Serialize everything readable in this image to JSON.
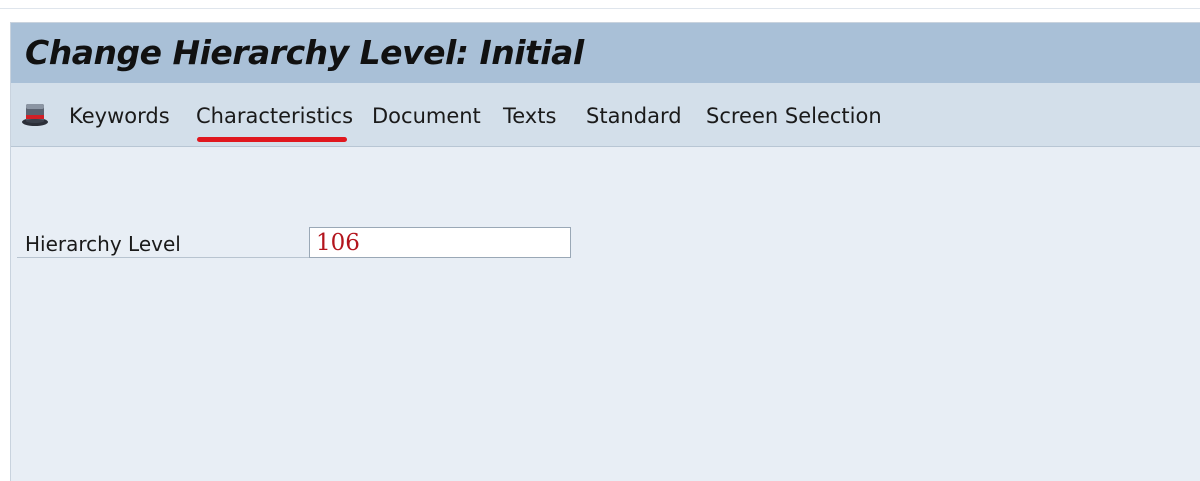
{
  "window": {
    "title": "Change Hierarchy Level: Initial"
  },
  "toolbar": {
    "icon": "hat-icon",
    "items": [
      {
        "label": "Keywords"
      },
      {
        "label": "Characteristics"
      },
      {
        "label": "Document"
      },
      {
        "label": "Texts"
      },
      {
        "label": "Standard"
      },
      {
        "label": "Screen Selection"
      }
    ],
    "highlighted_item": "Characteristics",
    "highlight_color": "#e0171e"
  },
  "form": {
    "hierarchy_level": {
      "label": "Hierarchy Level",
      "value": "106",
      "value_color": "#b3141c"
    }
  },
  "colors": {
    "title_bar": "#a9c0d7",
    "toolbar": "#d3dfea",
    "background": "#e8eef5"
  }
}
